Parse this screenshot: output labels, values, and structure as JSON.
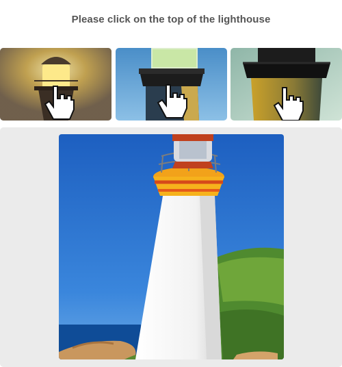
{
  "prompt": "Please click on the top of the lighthouse",
  "examples": [
    {
      "icon": "hand-pointer-icon"
    },
    {
      "icon": "hand-pointer-icon"
    },
    {
      "icon": "hand-pointer-icon"
    }
  ]
}
